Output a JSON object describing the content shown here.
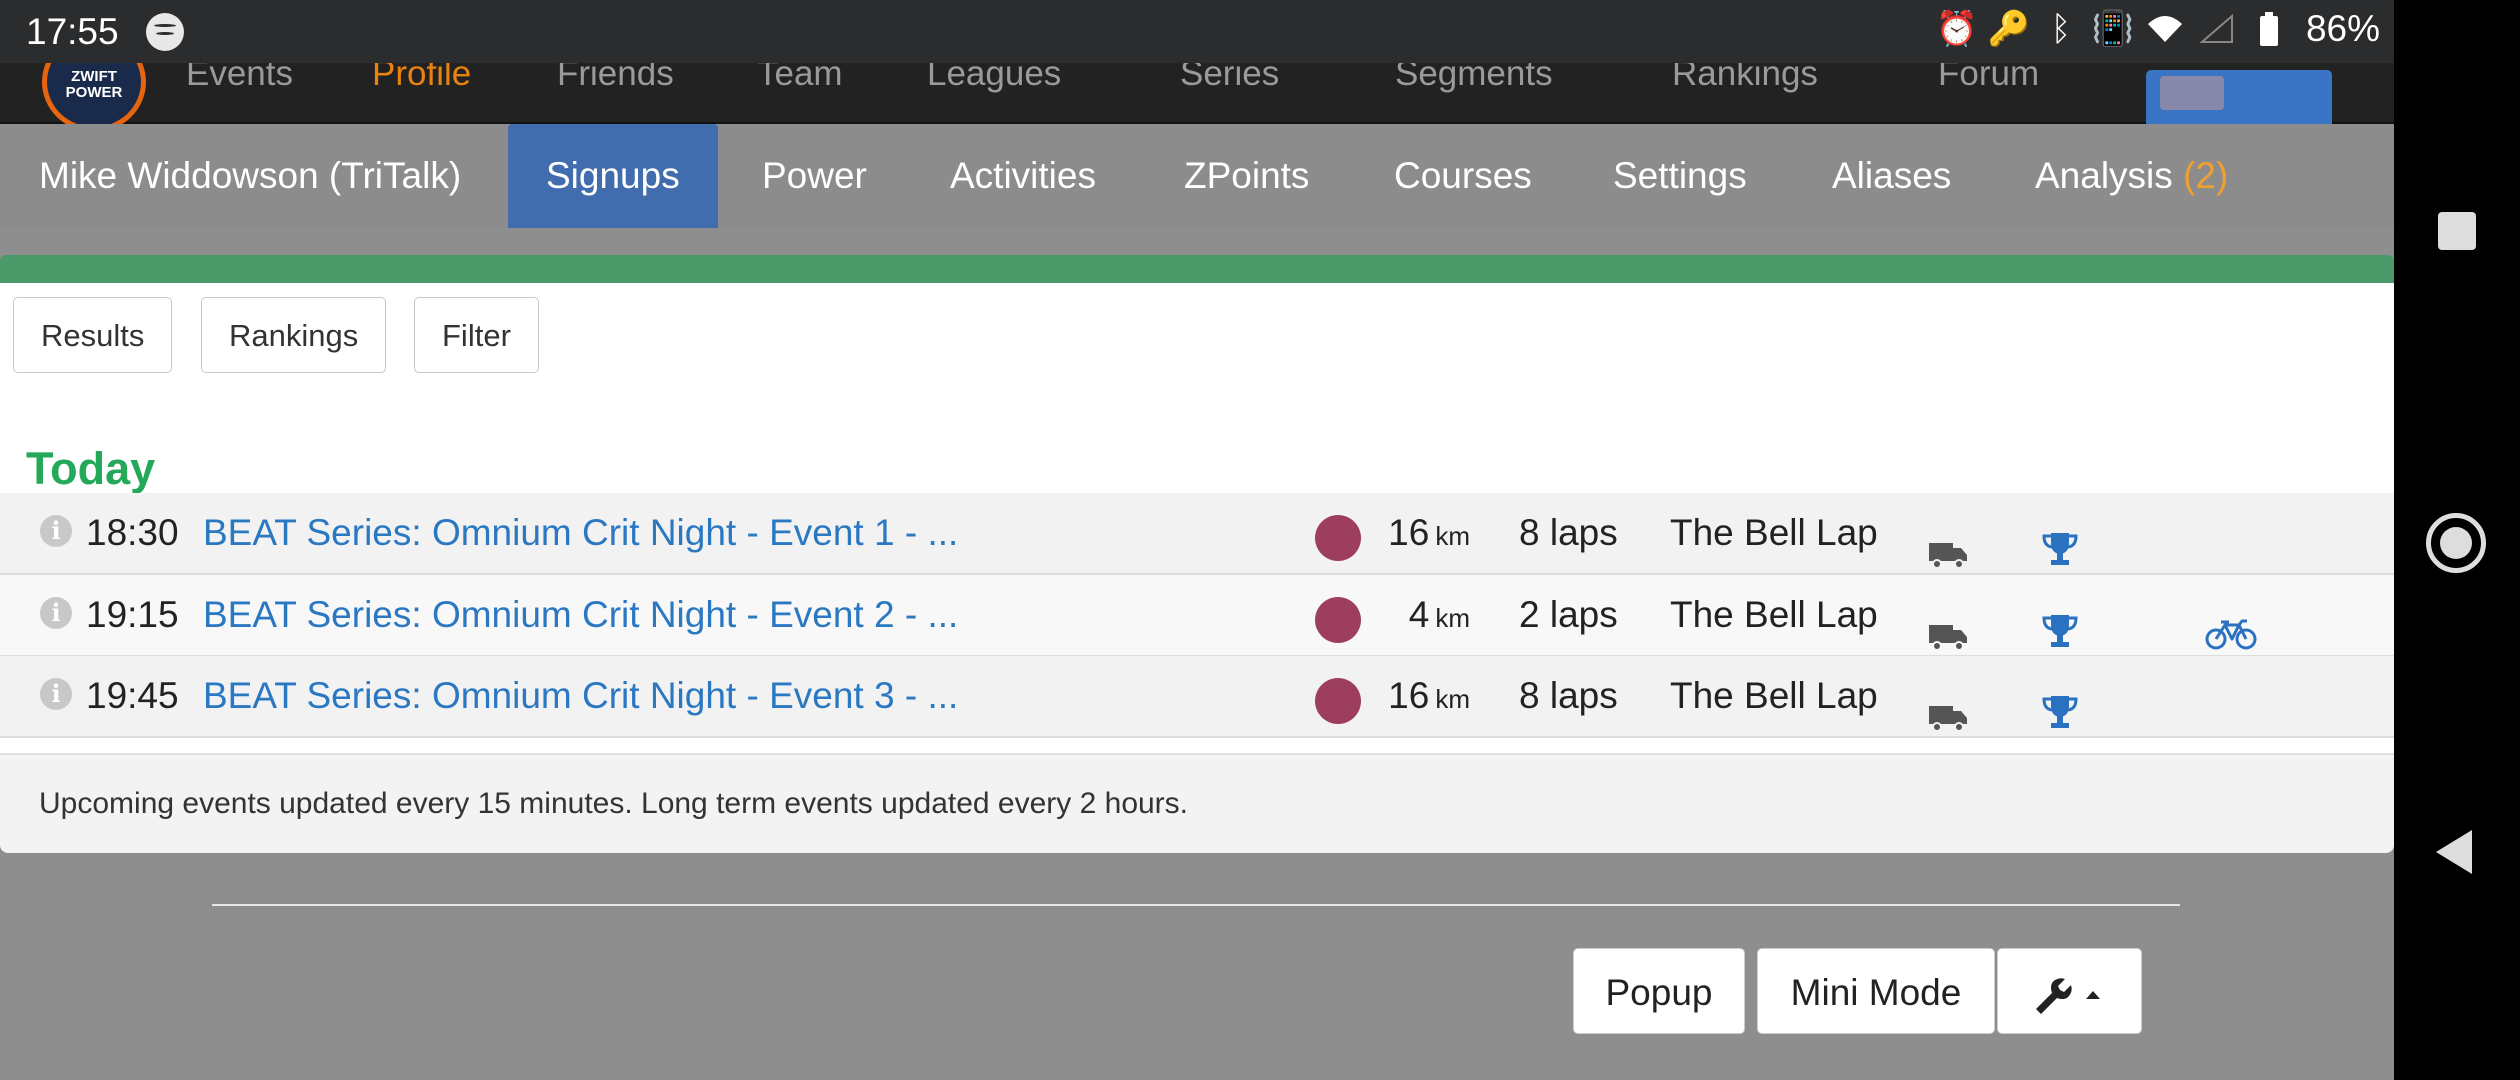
{
  "status_bar": {
    "time": "17:55",
    "battery": "86%"
  },
  "top_nav": {
    "logo": "ZWIFT POWER",
    "items": [
      "Events",
      "Profile",
      "Friends",
      "Team",
      "Leagues",
      "Series",
      "Segments",
      "Rankings",
      "Forum"
    ]
  },
  "profile_tabs": {
    "name": "Mike Widdowson (TriTalk)",
    "items": [
      "Signups",
      "Power",
      "Activities",
      "ZPoints",
      "Courses",
      "Settings",
      "Aliases"
    ],
    "analysis_label": "Analysis",
    "analysis_count": "(2)"
  },
  "toolbar": {
    "results": "Results",
    "rankings": "Rankings",
    "filter": "Filter"
  },
  "section_title": "Today",
  "events": [
    {
      "time": "18:30",
      "title": "BEAT Series: Omnium Crit Night - Event 1 - ...",
      "distance": "16",
      "unit": "km",
      "laps": "8 laps",
      "route": "The Bell Lap"
    },
    {
      "time": "19:15",
      "title": "BEAT Series: Omnium Crit Night - Event 2 - ...",
      "distance": "4",
      "unit": "km",
      "laps": "2 laps",
      "route": "The Bell Lap"
    },
    {
      "time": "19:45",
      "title": "BEAT Series: Omnium Crit Night - Event 3 - ...",
      "distance": "16",
      "unit": "km",
      "laps": "8 laps",
      "route": "The Bell Lap"
    }
  ],
  "footer_note": "Upcoming events updated every 15 minutes. Long term events updated every 2 hours.",
  "bottom_buttons": {
    "popup": "Popup",
    "mini_mode": "Mini Mode"
  },
  "colors": {
    "tab_active": "#416dae",
    "accent_green": "#24a859",
    "link_blue": "#2b78c2",
    "category_dot": "#9e3e5e"
  }
}
